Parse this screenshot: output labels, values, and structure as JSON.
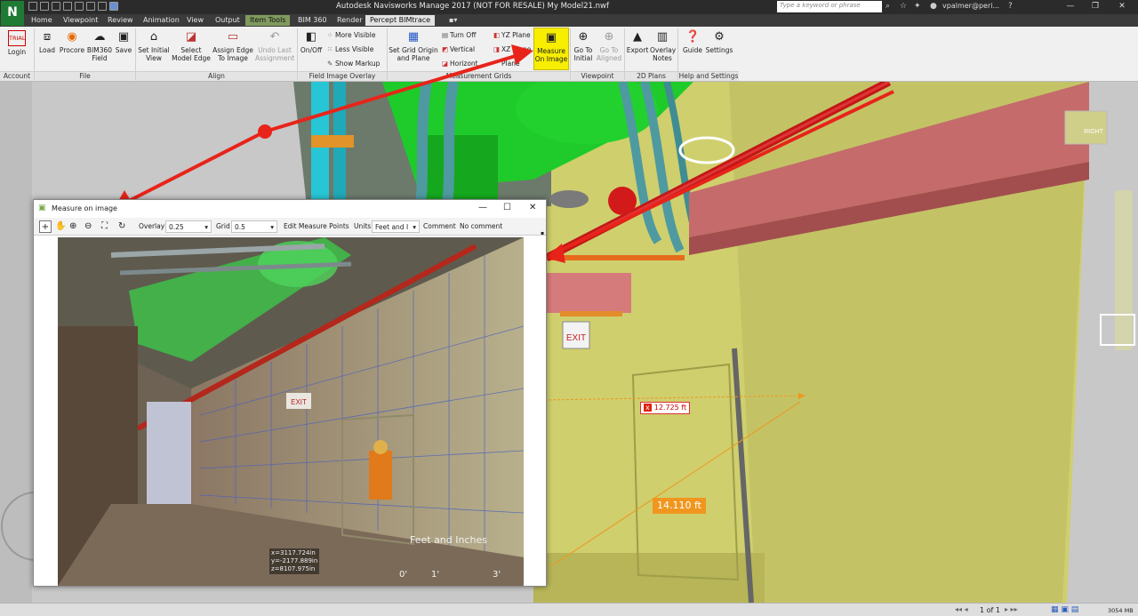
{
  "app": {
    "title": "Autodesk Navisworks Manage 2017 (NOT FOR RESALE)    My Model21.nwf",
    "logo": "N",
    "search_placeholder": "Type a keyword or phrase",
    "user": "vpalmer@peri..."
  },
  "tabs": [
    "Home",
    "Viewpoint",
    "Review",
    "Animation",
    "View",
    "Output",
    "Item Tools",
    "BIM 360",
    "Render",
    "Percept BIMtrace"
  ],
  "ribbon": {
    "login": "Login",
    "trial_badge": "TRIAL",
    "load": "Load",
    "procore": "Procore",
    "bim360_field": "BIM360 Field",
    "save": "Save",
    "set_initial_view": "Set Initial View",
    "select_model_edge": "Select Model Edge",
    "assign_edge": "Assign Edge To Image",
    "undo_last": "Undo Last Assignment",
    "on_off": "On/Off",
    "more_visible": "More Visible",
    "less_visible": "Less Visible",
    "show_markup": "Show Markup",
    "set_grid_origin": "Set Grid Origin and Plane",
    "turn_off": "Turn Off",
    "vertical": "Vertical",
    "horizontal": "Horizont",
    "yz_plane": "YZ Plane",
    "xz_plane": "XZ Plane",
    "plane": "Plane",
    "measure_on_image": "Measure On Image",
    "go_to_initial": "Go To Initial",
    "go_to_aligned": "Go To Aligned",
    "export": "Export",
    "overlay_notes": "Overlay Notes",
    "guide": "Guide",
    "settings": "Settings"
  },
  "panels": {
    "account": "Account",
    "file": "File",
    "align": "Align",
    "field_image_overlay": "Field Image Overlay",
    "measurement_grids": "Measurement Grids",
    "viewpoint": "Viewpoint",
    "plans_2d": "2D Plans",
    "help": "Help and Settings"
  },
  "viewport": {
    "measure_small": "12.725 ft",
    "measure_big": "14.110 ft",
    "viewcube_label": "RIGHT",
    "sign": "EXIT"
  },
  "dialog": {
    "title": "Measure on image",
    "overlay_label": "Overlay",
    "overlay_value": "0.25",
    "grid_label": "Grid",
    "grid_value": "0.5",
    "edit_points": "Edit Measure Points",
    "units_label": "Units",
    "units_value": "Feet and I",
    "comment_label": "Comment",
    "comment_value": "No comment",
    "scale_title": "Feet and Inches",
    "scale_ticks": [
      "0'",
      "1'",
      "3'"
    ],
    "coords": [
      "x=3117.724in",
      "y=-2177.889in",
      "z=8107.975in"
    ],
    "sign": "EXIT"
  },
  "status": {
    "page": "1 of 1",
    "memory": "3054 MB"
  },
  "colors": {
    "accent_yellow": "#f7ee00",
    "arrow_red": "#e8241a",
    "measure_orange": "#f0961e"
  }
}
